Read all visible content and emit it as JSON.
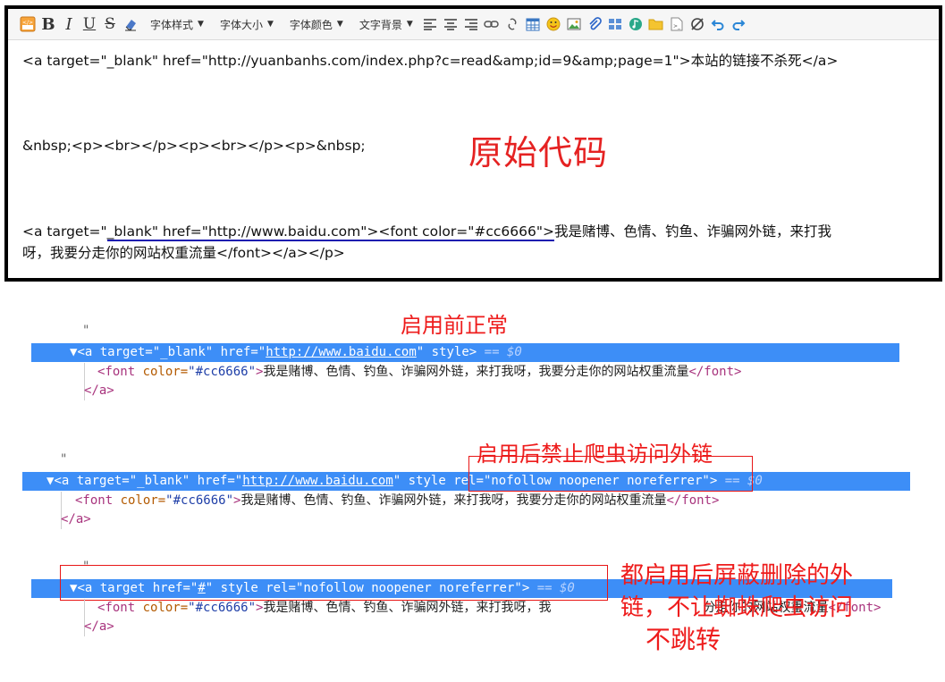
{
  "toolbar": {
    "font_style": "字体样式",
    "font_size": "字体大小",
    "font_color": "字体颜色",
    "text_bg": "文字背景"
  },
  "editor": {
    "line1": "<a target=\"_blank\" href=\"http://yuanbanhs.com/index.php?c=read&amp;id=9&amp;page=1\">本站的链接不杀死</a>",
    "line2": "&nbsp;<p><br></p><p><br></p><p>&nbsp;",
    "line3_start": "<a target=\"",
    "line3_underlined": "_blank\" href=\"http://www.baidu.com\"><font color=\"#cc6666\">",
    "line3_end": "我是赌博、色情、钓鱼、诈骗网外链，来打我",
    "line4": "呀，我要分走你的网站权重流量</font></a></p>",
    "annotation": "原始代码"
  },
  "sections": [
    {
      "label": "启用前正常",
      "quote": "\"",
      "row": {
        "open": "<a ",
        "a1": "target=",
        "v1": "\"_blank\"",
        "a2": " href=",
        "v2q1": "\"",
        "v2link": "http://www.baidu.com",
        "v2q2": "\"",
        "a3": " style",
        "close": ">",
        "eq": " == $0"
      },
      "child": {
        "open": "<font ",
        "attr": "color=",
        "val": "\"#cc6666\"",
        "gt": ">",
        "text": "我是赌博、色情、钓鱼、诈骗网外链，来打我呀，我要分走你的网站权重流量",
        "close": "</font>"
      },
      "end": "</a>"
    },
    {
      "label": "启用后禁止爬虫访问外链",
      "quote": "\"",
      "row": {
        "open": "<a ",
        "a1": "target=",
        "v1": "\"_blank\"",
        "a2": " href=",
        "v2q1": "\"",
        "v2link": "http://www.baidu.com",
        "v2q2": "\"",
        "a3": " style ",
        "a4": "rel=",
        "v4": "\"nofollow noopener noreferrer\"",
        "close": ">",
        "eq": " == $0"
      },
      "child": {
        "open": "<font ",
        "attr": "color=",
        "val": "\"#cc6666\"",
        "gt": ">",
        "text": "我是赌博、色情、钓鱼、诈骗网外链，来打我呀，我要分走你的网站权重流量",
        "close": "</font>"
      },
      "end": "</a>"
    },
    {
      "label_line1": "都启用后屏蔽删除的外",
      "label_line2": "链，不让蜘蛛爬虫访问",
      "label_line3": "不跳转",
      "quote": "\"",
      "row": {
        "open": "<a ",
        "a1": "target ",
        "a2": "href=",
        "v2q1": "\"",
        "v2link": "#",
        "v2q2": "\"",
        "a3": " style ",
        "a4": "rel=",
        "v4": "\"nofollow noopener noreferrer\"",
        "close": ">",
        "eq": " == $0"
      },
      "child": {
        "open": "<font ",
        "attr": "color=",
        "val": "\"#cc6666\"",
        "gt": ">",
        "text_a": "我是赌博、色情、钓鱼、诈骗网外链，来打我呀，我",
        "text_b": "分走你的网站权重流量",
        "close": "</font>"
      },
      "end": "</a>"
    }
  ],
  "colors": {
    "accent": "#3d8ef7",
    "annotation": "#ee1c1c",
    "underline": "#1a1ab0"
  }
}
